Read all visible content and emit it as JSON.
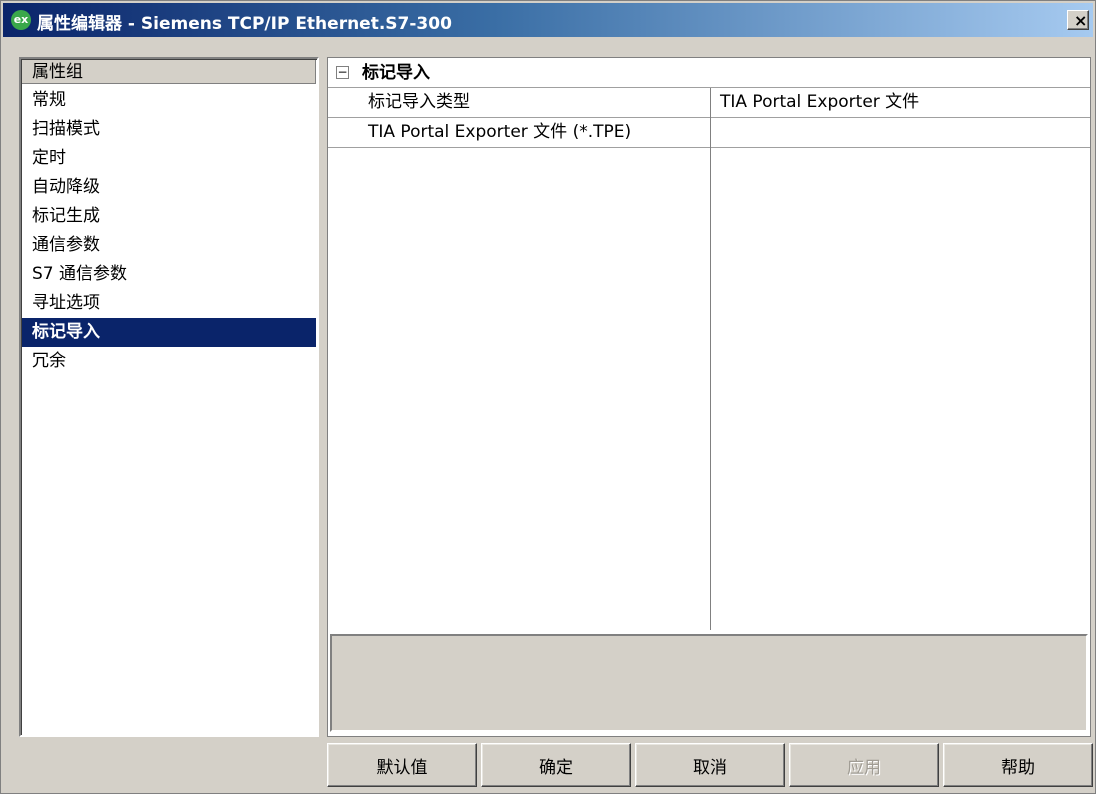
{
  "window": {
    "title": "属性编辑器 - Siemens TCP/IP Ethernet.S7-300",
    "icon": "ex"
  },
  "sidebar": {
    "header": "属性组",
    "items": [
      {
        "label": "常规"
      },
      {
        "label": "扫描模式"
      },
      {
        "label": "定时"
      },
      {
        "label": "自动降级"
      },
      {
        "label": "标记生成"
      },
      {
        "label": "通信参数"
      },
      {
        "label": "S7 通信参数"
      },
      {
        "label": "寻址选项"
      },
      {
        "label": "标记导入",
        "selected": true
      },
      {
        "label": "冗余"
      }
    ]
  },
  "property_grid": {
    "group_label": "标记导入",
    "rows": [
      {
        "name": "标记导入类型",
        "value": "TIA Portal Exporter 文件"
      },
      {
        "name": "TIA Portal Exporter 文件 (*.TPE)",
        "value": ""
      }
    ]
  },
  "buttons": {
    "default_label": "默认值",
    "ok_label": "确定",
    "cancel_label": "取消",
    "apply_label": "应用",
    "help_label": "帮助"
  },
  "colors": {
    "selection": "#0a246a",
    "window_bg": "#d4d0c8"
  }
}
